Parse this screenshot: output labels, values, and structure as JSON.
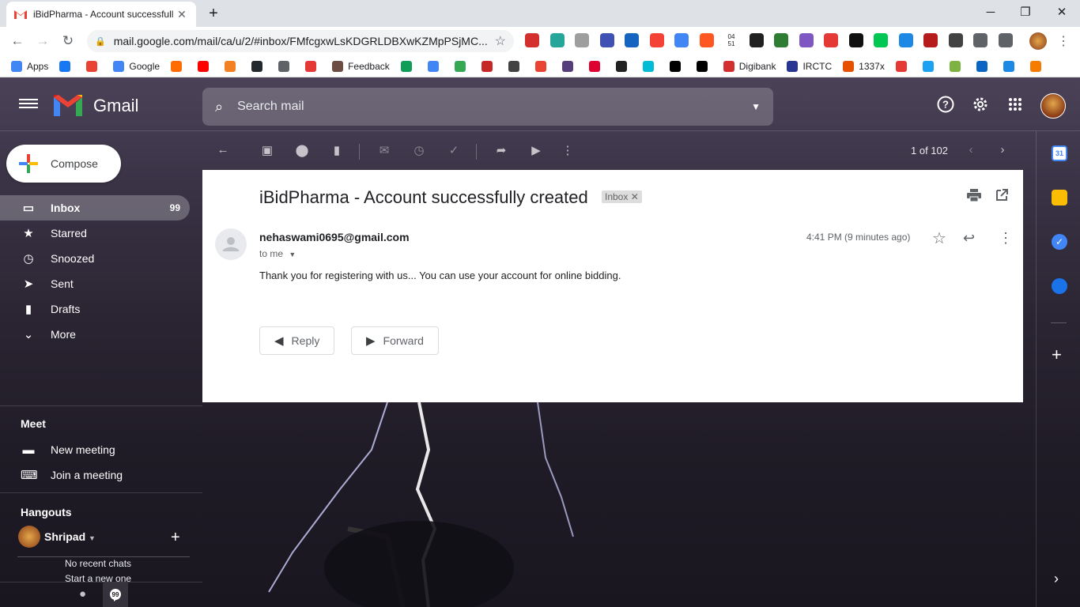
{
  "browser": {
    "tab_title": "iBidPharma - Account successfull",
    "new_tab": "+",
    "url": "mail.google.com/mail/ca/u/2/#inbox/FMfcgxwLsKDGRLDBXwKZMpPSjMC...",
    "minimize": "─",
    "restore": "❐",
    "close": "✕",
    "ext_clock": "04\n51",
    "bookmarks": [
      {
        "label": "Apps",
        "color": "#4285f4"
      },
      {
        "label": "",
        "color": "#1877f2"
      },
      {
        "label": "",
        "color": "#ea4335"
      },
      {
        "label": "Google",
        "color": "#4285f4"
      },
      {
        "label": "",
        "color": "#ff6d00"
      },
      {
        "label": "",
        "color": "#ff0000"
      },
      {
        "label": "",
        "color": "#f48024"
      },
      {
        "label": "",
        "color": "#24292e"
      },
      {
        "label": "",
        "color": "#5f6368"
      },
      {
        "label": "",
        "color": "#e53935"
      },
      {
        "label": "Feedback",
        "color": "#6d4c41"
      },
      {
        "label": "",
        "color": "#0f9d58"
      },
      {
        "label": "",
        "color": "#4285f4"
      },
      {
        "label": "",
        "color": "#34a853"
      },
      {
        "label": "",
        "color": "#c62828"
      },
      {
        "label": "",
        "color": "#424242"
      },
      {
        "label": "",
        "color": "#ea4335"
      },
      {
        "label": "",
        "color": "#563d7c"
      },
      {
        "label": "",
        "color": "#dd0031"
      },
      {
        "label": "",
        "color": "#222"
      },
      {
        "label": "",
        "color": "#00bcd4"
      },
      {
        "label": "",
        "color": "#000"
      },
      {
        "label": "",
        "color": "#000"
      },
      {
        "label": "Digibank",
        "color": "#d32f2f"
      },
      {
        "label": "IRCTC",
        "color": "#283593"
      },
      {
        "label": "1337x",
        "color": "#e65100"
      },
      {
        "label": "",
        "color": "#e53935"
      },
      {
        "label": "",
        "color": "#1da1f2"
      },
      {
        "label": "",
        "color": "#7cb342"
      },
      {
        "label": "",
        "color": "#0a66c2"
      },
      {
        "label": "",
        "color": "#1e88e5"
      },
      {
        "label": "",
        "color": "#f57c00"
      }
    ]
  },
  "gmail": {
    "brand": "Gmail",
    "search_placeholder": "Search mail",
    "compose": "Compose",
    "nav": [
      {
        "label": "Inbox",
        "count": "99",
        "icon": "inbox-icon"
      },
      {
        "label": "Starred",
        "count": "",
        "icon": "star-icon"
      },
      {
        "label": "Snoozed",
        "count": "",
        "icon": "clock-icon"
      },
      {
        "label": "Sent",
        "count": "",
        "icon": "send-icon"
      },
      {
        "label": "Drafts",
        "count": "",
        "icon": "draft-icon"
      },
      {
        "label": "More",
        "count": "",
        "icon": "chevron-down-icon"
      }
    ],
    "meet": {
      "title": "Meet",
      "new_meeting": "New meeting",
      "join": "Join a meeting"
    },
    "hangouts": {
      "title": "Hangouts",
      "user": "Shripad",
      "no_chats": "No recent chats",
      "start": "Start a new one"
    },
    "pager": "1 of 102",
    "email": {
      "subject": "iBidPharma - Account successfully created",
      "label": "Inbox",
      "from": "nehaswami0695@gmail.com",
      "to": "to me",
      "time": "4:41 PM (9 minutes ago)",
      "body": "Thank you for registering with us... You can use your account for online bidding.",
      "reply": "Reply",
      "forward": "Forward"
    }
  }
}
